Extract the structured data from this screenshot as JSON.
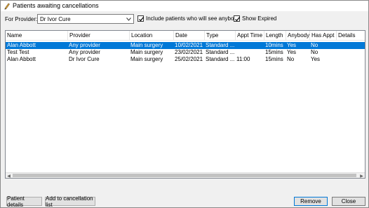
{
  "window": {
    "title": "Patients awaiting cancellations"
  },
  "filter": {
    "provider_label": "For Provider:",
    "provider_value": "Dr Ivor Cure",
    "include_anybody_label": "Include patients who will see anybody",
    "include_anybody_checked": true,
    "show_expired_label": "Show Expired",
    "show_expired_checked": true
  },
  "grid": {
    "columns": [
      "Name",
      "Provider",
      "Location",
      "Date",
      "Type",
      "Appt Time",
      "Length",
      "Anybody",
      "Has Appt",
      "Details"
    ],
    "rows": [
      {
        "selected": true,
        "cells": [
          "Alan Abbott",
          "Any provider",
          "Main surgery",
          "10/02/2021",
          "Standard ...",
          "",
          "10mins",
          "Yes",
          "No",
          ""
        ]
      },
      {
        "selected": false,
        "cells": [
          "Test Test",
          "Any provider",
          "Main surgery",
          "23/02/2021",
          "Standard ...",
          "",
          "15mins",
          "Yes",
          "No",
          ""
        ]
      },
      {
        "selected": false,
        "cells": [
          "Alan Abbott",
          "Dr Ivor Cure",
          "Main surgery",
          "25/02/2021",
          "Standard ...",
          "11:00",
          "15mins",
          "No",
          "Yes",
          ""
        ]
      }
    ]
  },
  "buttons": {
    "patient_details": "Patient details",
    "add_to_list": "Add to cancellation list",
    "remove": "Remove",
    "close": "Close"
  },
  "colors": {
    "selection": "#0078d7"
  }
}
